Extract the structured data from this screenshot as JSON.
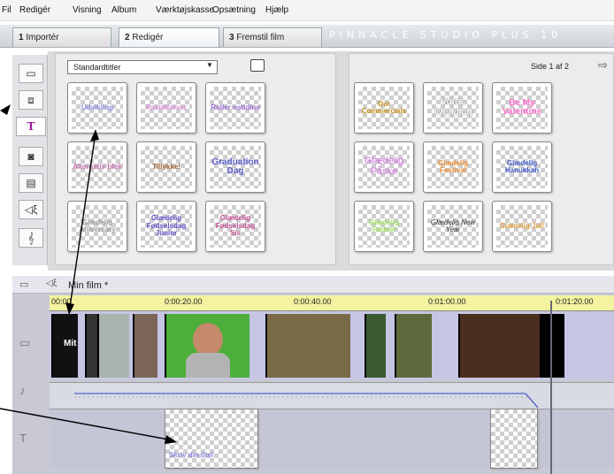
{
  "menu": [
    "Fil",
    "Redigér",
    "Visning",
    "Album",
    "Værktøjskasse",
    "Opsætning",
    "Hjælp"
  ],
  "tabs": [
    {
      "num": "1",
      "label": "Importér"
    },
    {
      "num": "2",
      "label": "Redigér"
    },
    {
      "num": "3",
      "label": "Fremstil film"
    }
  ],
  "brand": "PINNACLE STUDIO PLUS 10",
  "album": {
    "dropdown_value": "Standardtitler",
    "page_label": "Side 1 af 2"
  },
  "thumbnails_left": [
    {
      "text": "Udvikling",
      "color": "#8b8be0"
    },
    {
      "text": "Pastelfarver",
      "color": "#d990d8"
    },
    {
      "text": "Ruller ostidine",
      "color": "#9b6fd0"
    },
    {
      "text": "Alternativ blok",
      "color": "#c86fb0"
    },
    {
      "text": "Tillykke!",
      "color": "#a06030"
    },
    {
      "text": "Graduation Dag",
      "color": "#5c5fc9"
    },
    {
      "text": "Glædelig Aniversary",
      "color": "#9a9a9a"
    },
    {
      "text": "Glædelig Fødselsdag Junior",
      "color": "#6a4fc9"
    },
    {
      "text": "Glædelig Fødselsdag Sis",
      "color": "#c04f90"
    }
  ],
  "thumbnails_right": [
    {
      "text": "Our Commercials",
      "color": "#c8901a"
    },
    {
      "text": "Vores Wedding",
      "color": "#ffffff"
    },
    {
      "text": "Be My Valentine",
      "color": "#ff70d0"
    },
    {
      "text": "Glædelig Påske",
      "color": "#d070e0"
    },
    {
      "text": "Glædelig Festival",
      "color": "#e88a30"
    },
    {
      "text": "Glædelig Hanukkah",
      "color": "#4058c8"
    },
    {
      "text": "Glædelig Fødsel",
      "color": "#9ae060"
    },
    {
      "text": "Glædelig New Year",
      "color": "#333333"
    },
    {
      "text": "Glædelig Jul!",
      "color": "#e0a040"
    }
  ],
  "timeline": {
    "film_title": "Min film *",
    "ticks": [
      "00:00",
      "0:00:20.00",
      "0:00:40.00",
      "0:01:00.00",
      "0:01:20.00"
    ],
    "title_clip_text": "Skriv din titel",
    "first_clip_text": "Mit"
  }
}
